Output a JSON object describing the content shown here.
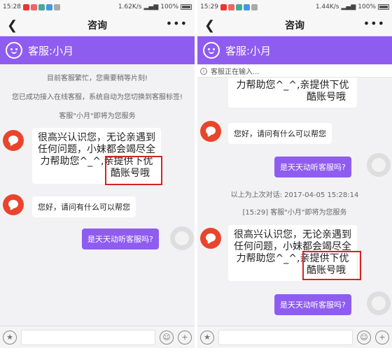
{
  "left": {
    "status": {
      "time": "15:28",
      "speed": "1.62K/s",
      "battery": "100%"
    },
    "title": "咨询",
    "agent": "客服:小月",
    "system": [
      "目前客服繁忙，您需要稍等片刻!",
      "您已成功接入在线客服，系统自动为您切换到客服标签!",
      "客服\"小月\"即将为您服务"
    ],
    "greeting": {
      "l1": "很高兴认识您，无论亲遇到",
      "l2": "任何问题，小妹都会竭尽全",
      "l3a": "力帮助您^_^,",
      "l3b": "亲提供下优",
      "l4": "酷账号哦"
    },
    "reply": "您好，请问有什么可以帮您",
    "user_msg": "是天天动听客服吗?"
  },
  "right": {
    "status": {
      "time": "15:29",
      "speed": "1.44K/s",
      "battery": "100%"
    },
    "title": "咨询",
    "agent": "客服:小月",
    "typing": "客服正在输入...",
    "top_partial": {
      "l1": "力帮助您^_^,亲提供下优",
      "l2": "酷账号哦"
    },
    "reply": "您好，请问有什么可以帮您",
    "user_msg": "是天天动听客服吗?",
    "history": "以上为上次对话: 2017-04-05 15:28:14",
    "service_note": "[15:29] 客服\"小月\"即将为您服务",
    "greeting": {
      "l1": "很高兴认识您，无论亲遇到",
      "l2": "任何问题，小妹都会竭尽全",
      "l3a": "力帮助您^_^,",
      "l3b": "亲提供下优",
      "l4": "酷账号哦"
    },
    "user_msg2": "是天天动听客服吗?"
  },
  "icons": {
    "star": "star-icon",
    "emoji": "emoji-icon",
    "plus": "plus-icon",
    "info": "info-icon"
  },
  "colors": {
    "accent": "#8f5cf0",
    "avatar": "#e8452c",
    "highlight": "#d62222"
  }
}
